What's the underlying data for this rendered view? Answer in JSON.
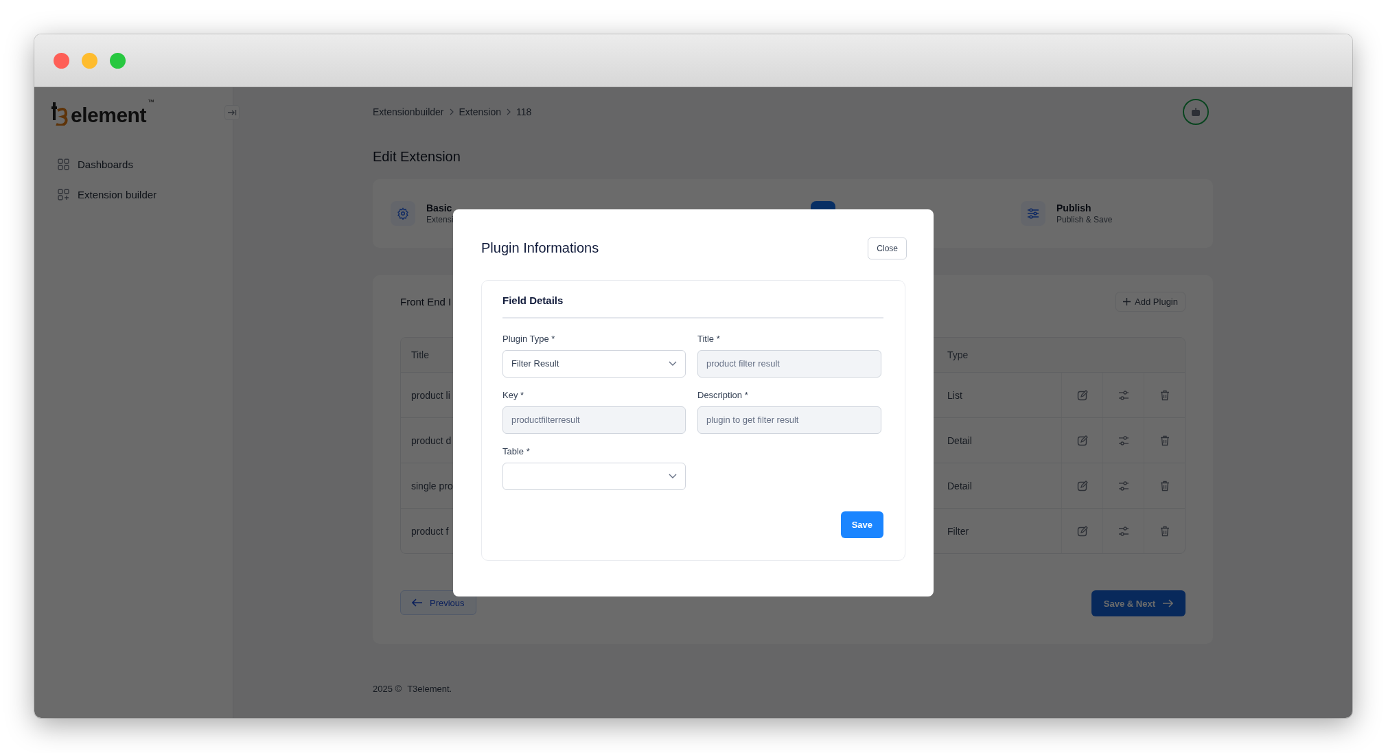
{
  "sidebar": {
    "logo": {
      "text": "element",
      "trademark": "™"
    },
    "items": [
      {
        "label": "Dashboards",
        "kind": "grid"
      },
      {
        "label": "Extension builder",
        "kind": "grid-add"
      }
    ]
  },
  "breadcrumb": [
    "Extensionbuilder",
    "Extension",
    "118"
  ],
  "page_title": "Edit Extension",
  "steps": [
    {
      "kind": "settings",
      "title": "Basic",
      "subtitle": "Extensi",
      "selected": false
    },
    {
      "kind": "current",
      "selected": true
    },
    {
      "kind": "sliders",
      "title": "Publish",
      "subtitle": "Publish & Save",
      "selected": false
    }
  ],
  "front_end": {
    "title": "Front End I",
    "add_button": "Add Plugin",
    "columns": [
      "Title",
      "Type"
    ],
    "rows": [
      {
        "title": "product li",
        "type": "List"
      },
      {
        "title": "product d",
        "type": "Detail"
      },
      {
        "title": "single pro",
        "type": "Detail"
      },
      {
        "title": "product f",
        "type": "Filter"
      }
    ],
    "previous_button": "Previous",
    "next_button": "Save & Next"
  },
  "footer": {
    "year": "2025 ©",
    "brand": "T3element."
  },
  "modal": {
    "title": "Plugin Informations",
    "close_button": "Close",
    "section_title": "Field Details",
    "fields": [
      {
        "label": "Plugin Type *",
        "kind": "select",
        "value": "Filter Result",
        "disabled": false
      },
      {
        "label": "Title *",
        "kind": "text",
        "value": "product filter result",
        "disabled": true
      },
      {
        "label": "Key *",
        "kind": "text",
        "value": "productfilterresult",
        "disabled": true
      },
      {
        "label": "Description *",
        "kind": "text",
        "value": "plugin to get filter result",
        "disabled": true
      },
      {
        "label": "Table *",
        "kind": "select",
        "disabled": false
      }
    ],
    "save_button": "Save"
  }
}
